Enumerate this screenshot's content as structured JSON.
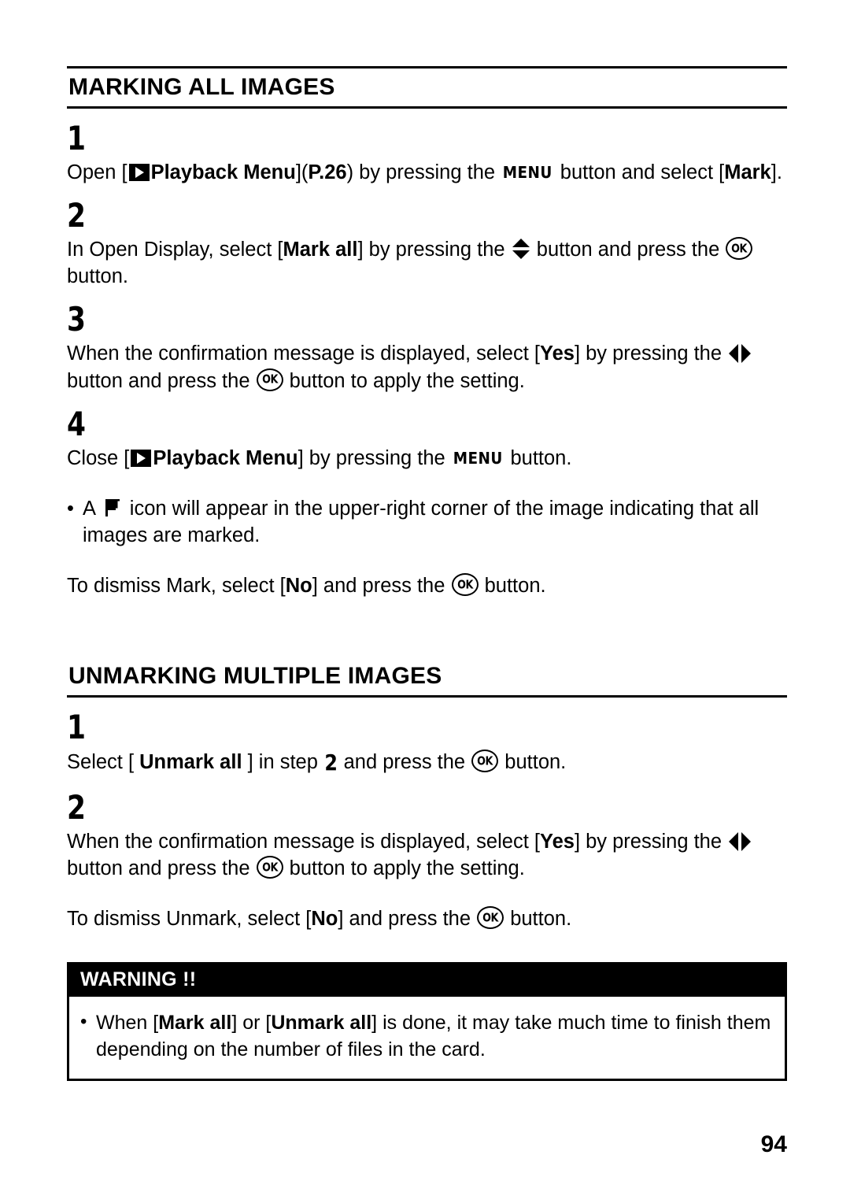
{
  "page": {
    "number": "94"
  },
  "sections": [
    {
      "heading": "MARKING ALL IMAGES",
      "steps": [
        {
          "number": "1",
          "text_1": "Open [",
          "icon": "playback-menu-icon",
          "text_2": "Playback Menu",
          "text_3": "](",
          "text_4": "P.26",
          "text_5": ") by pressing the ",
          "menu_label": "MENU",
          "text_6": " button and select [",
          "text_7": "Mark",
          "text_8": "]."
        },
        {
          "number": "2",
          "text_1": "In Open Display, select [",
          "text_2": "Mark all",
          "text_3": "] by pressing the ",
          "icon_1": "up-down-arrow-icon",
          "text_4": " button and press the ",
          "icon_2": "ok-button-icon",
          "ok_label": "OK",
          "text_5": " button."
        },
        {
          "number": "3",
          "text_1": "When the confirmation message is displayed, select [",
          "text_2": "Yes",
          "text_3": "] by pressing the ",
          "icon_1": "left-right-arrow-icon",
          "text_4": " button and press the ",
          "icon_2": "ok-button-icon",
          "ok_label": "OK",
          "text_5": " button to apply the setting."
        },
        {
          "number": "4",
          "text_1": "Close [",
          "icon": "playback-menu-icon",
          "text_2": "Playback Menu",
          "text_3": "] by pressing the ",
          "menu_label": "MENU",
          "text_4": " button."
        }
      ],
      "notes": [
        {
          "bullet": "•",
          "text_1": "A ",
          "icon": "flag-mark-icon",
          "text_2": " icon will appear in the upper-right corner of the image indicating that all images are marked."
        }
      ],
      "dismiss": {
        "text_1": "To dismiss Mark, select [",
        "text_2": "No",
        "text_3": "] and press the ",
        "icon": "ok-button-icon",
        "ok_label": "OK",
        "text_4": " button."
      }
    },
    {
      "heading": "UNMARKING MULTIPLE IMAGES",
      "steps": [
        {
          "number": "1",
          "text_1": "Select [ ",
          "text_2": "Unmark all",
          "text_3": " ] in step ",
          "inline_step": "2",
          "text_4": " and press the ",
          "icon": "ok-button-icon",
          "ok_label": "OK",
          "text_5": " button."
        },
        {
          "number": "2",
          "text_1": "When the confirmation message is displayed, select [",
          "text_2": "Yes",
          "text_3": "] by pressing the ",
          "icon_1": "left-right-arrow-icon",
          "text_4": " button and press the ",
          "icon_2": "ok-button-icon",
          "ok_label": "OK",
          "text_5": " button to apply the setting."
        }
      ],
      "dismiss": {
        "text_1": "To dismiss Unmark, select [",
        "text_2": "No",
        "text_3": "] and press the ",
        "icon": "ok-button-icon",
        "ok_label": "OK",
        "text_4": " button."
      }
    }
  ],
  "warning": {
    "title": "WARNING !!",
    "bullet": "•",
    "text_1": "When [",
    "text_2": "Mark all",
    "text_3": "] or [",
    "text_4": "Unmark all",
    "text_5": "] is done, it may take much time to finish them depending on the number of files in the card."
  }
}
